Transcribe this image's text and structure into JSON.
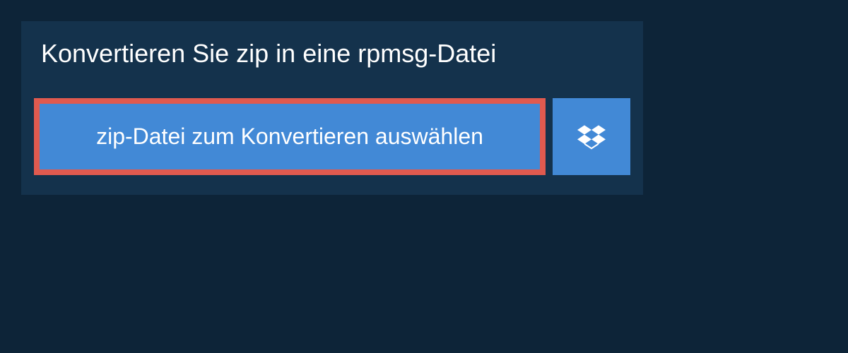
{
  "title": "Konvertieren Sie zip in eine rpmsg-Datei",
  "selectButton": "zip-Datei zum Konvertieren auswählen"
}
